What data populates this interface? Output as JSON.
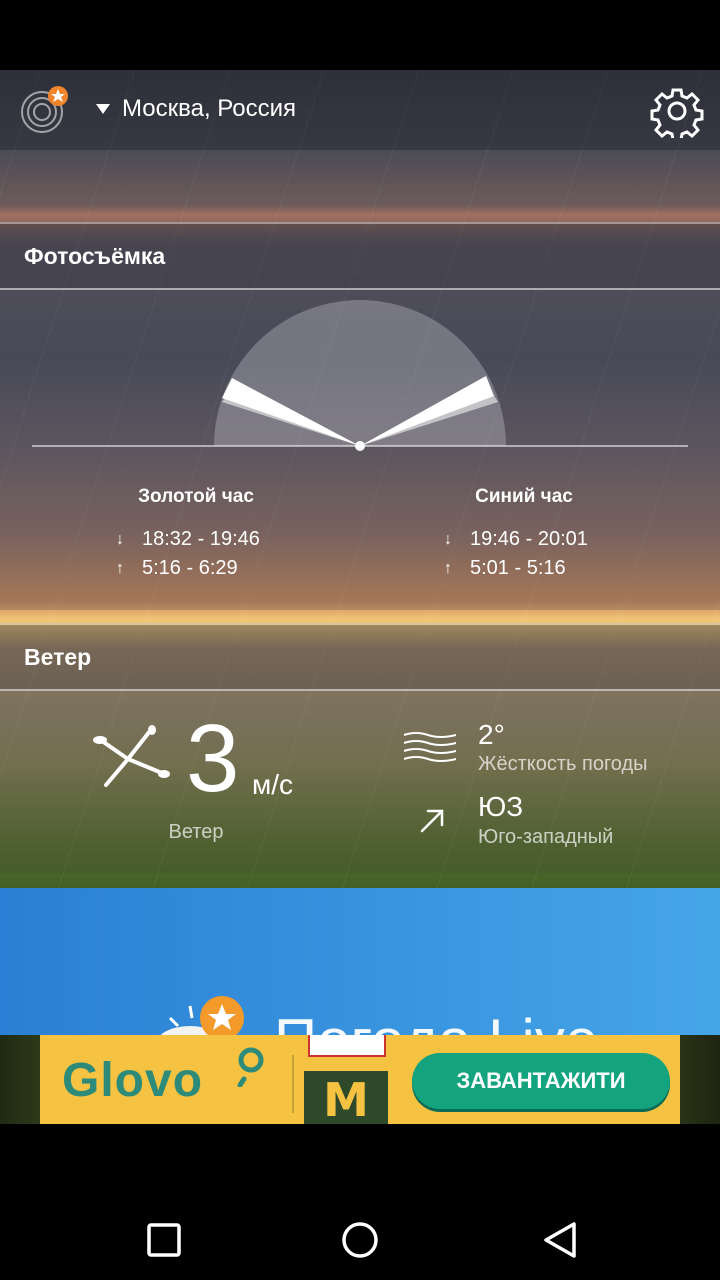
{
  "header": {
    "location": "Москва, Россия",
    "radar_icon": "radar-star-icon",
    "settings_icon": "gear-icon"
  },
  "photo": {
    "title": "Фотосъёмка",
    "golden_hour": {
      "title": "Золотой час",
      "evening": "18:32 - 19:46",
      "morning": "5:16 - 6:29"
    },
    "blue_hour": {
      "title": "Синий час",
      "evening": "19:46 - 20:01",
      "morning": "5:01 - 5:16"
    }
  },
  "wind": {
    "title": "Ветер",
    "speed": "3",
    "unit": "м/с",
    "label": "Ветер",
    "severity_value": "2°",
    "severity_label": "Жёсткость погоды",
    "direction_value": "ЮЗ",
    "direction_label": "Юго-западный"
  },
  "promo": {
    "text": "Погода Live"
  },
  "ad": {
    "brand": "Glovo",
    "cta": "ЗАВАНТАЖИТИ",
    "secondary_logo": "M",
    "colors": {
      "background": "#f5c242",
      "brand": "#2e8b7a",
      "cta": "#13a37f"
    }
  },
  "nav": {
    "recents_icon": "square-icon",
    "home_icon": "circle-icon",
    "back_icon": "triangle-back-icon"
  }
}
